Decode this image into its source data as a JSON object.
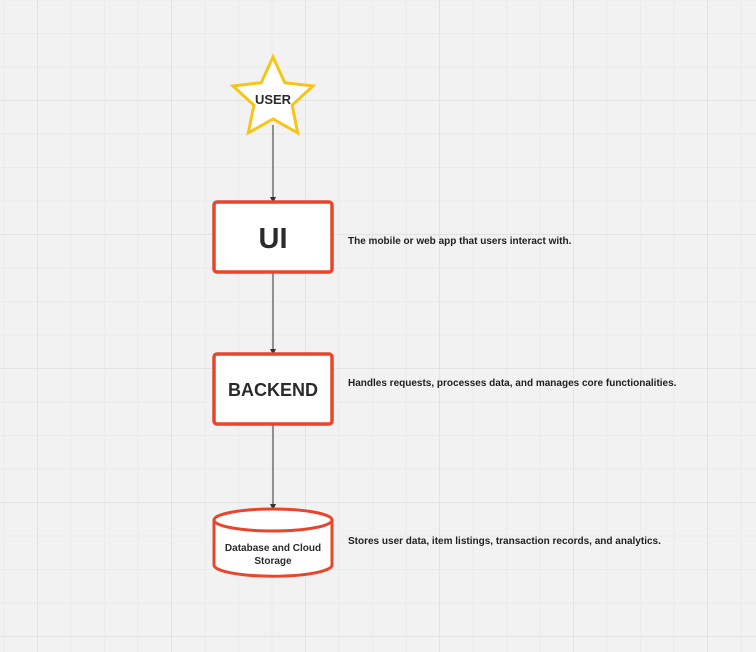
{
  "colors": {
    "node_border": "#e8452c",
    "node_fill": "#ffffff",
    "star_border": "#f5c518",
    "connector": "#333333",
    "canvas": "#f2f2f2"
  },
  "nodes": {
    "user": {
      "label": "USER",
      "shape": "star"
    },
    "ui": {
      "label": "UI",
      "shape": "rectangle"
    },
    "backend": {
      "label": "BACKEND",
      "shape": "rectangle"
    },
    "database": {
      "label_line1": "Database and Cloud",
      "label_line2": "Storage",
      "shape": "cylinder"
    }
  },
  "descriptions": {
    "ui": "The mobile or web app that users interact with.",
    "backend": "Handles requests, processes data, and manages core functionalities.",
    "database": "Stores user data, item listings, transaction records, and analytics."
  }
}
